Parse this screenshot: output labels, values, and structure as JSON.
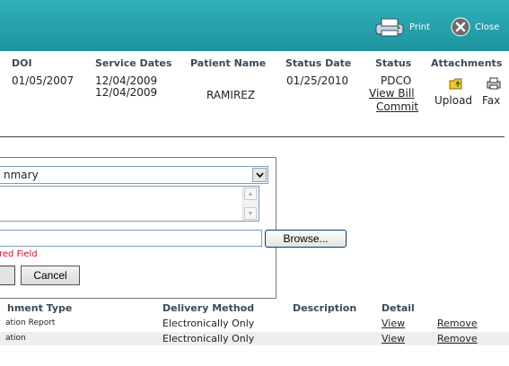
{
  "toolbar": {
    "print_label": "Print",
    "close_label": "Close",
    "bg_color": "#23a3ad"
  },
  "claims_table": {
    "headers": {
      "doi": "DOI",
      "service_dates": "Service Dates",
      "patient_name": "Patient Name",
      "status_date": "Status Date",
      "status": "Status",
      "attachments": "Attachments"
    },
    "row": {
      "doi": "01/05/2007",
      "service_date_from": "12/04/2009",
      "service_date_to": "12/04/2009",
      "patient_name": "RAMIREZ",
      "status_date": "01/25/2010",
      "status": "PDCO",
      "view_bill": "View Bill",
      "commit": "Commit",
      "upload": "Upload",
      "fax": "Fax"
    }
  },
  "attach_form": {
    "type_select_value": "nmary",
    "browse_label": "Browse...",
    "required_note": "red Field",
    "cancel_label": "Cancel"
  },
  "attachments_list": {
    "headers": {
      "type": "hment Type",
      "delivery_method": "Delivery Method",
      "description": "Description",
      "detail": "Detail"
    },
    "rows": [
      {
        "type": "ation Report",
        "delivery": "Electronically Only",
        "description": "",
        "view": "View",
        "remove": "Remove"
      },
      {
        "type": "ation",
        "delivery": "Electronically Only",
        "description": "",
        "view": "View",
        "remove": "Remove"
      }
    ]
  }
}
